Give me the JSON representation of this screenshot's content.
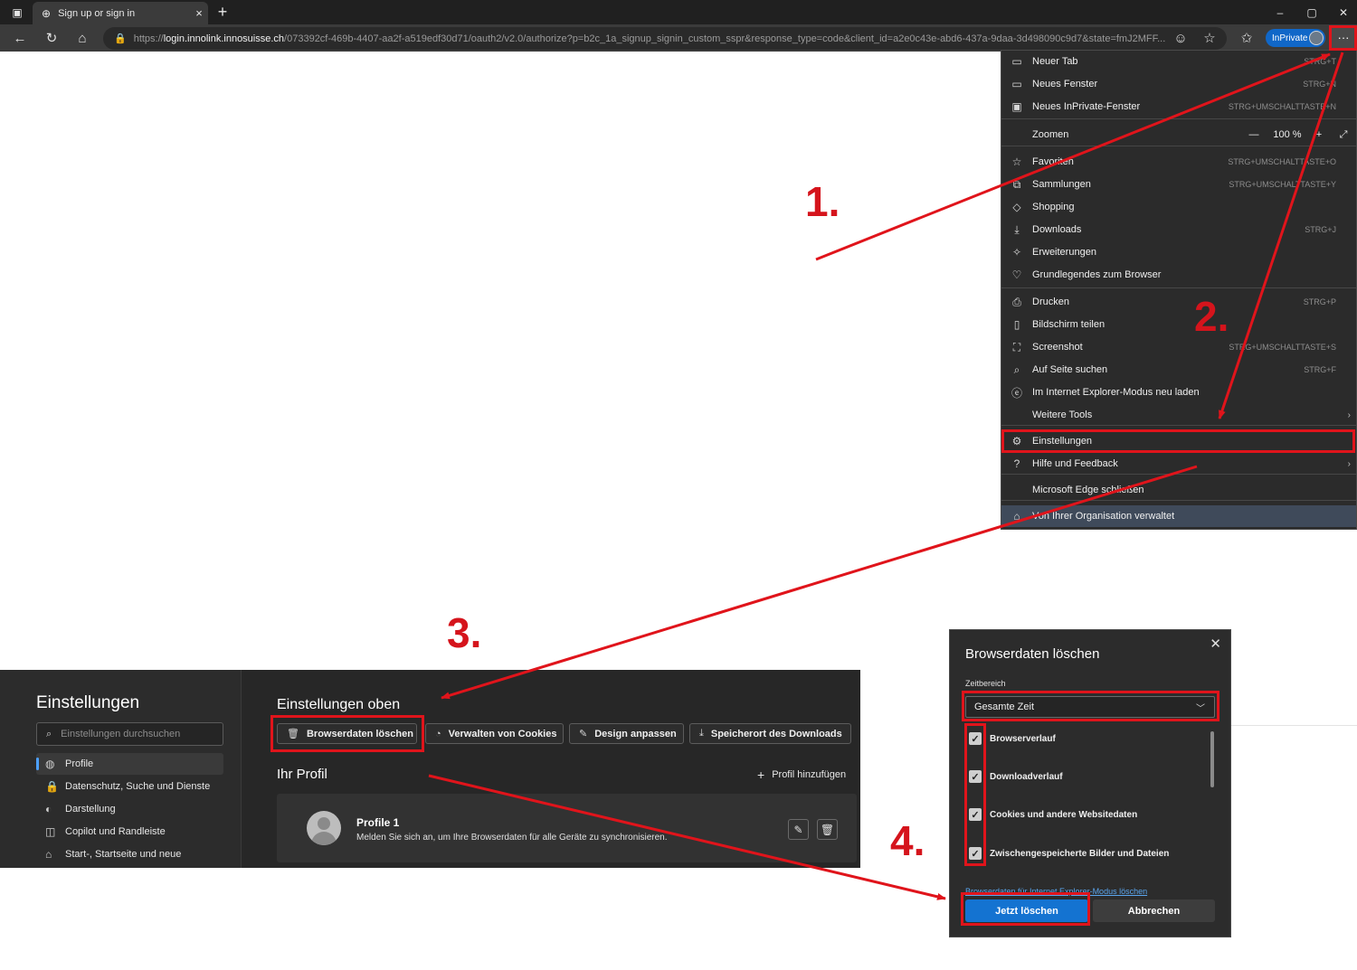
{
  "browser": {
    "tab_title": "Sign up or sign in",
    "tab_close": "×",
    "new_tab": "+",
    "window_controls": {
      "minimize": "–",
      "restore": "▢",
      "close": "✕"
    },
    "url_scheme": "https://",
    "url_host": "login.innolink.innosuisse.ch",
    "url_rest": "/073392cf-469b-4407-aa2f-a519edf30d71/oauth2/v2.0/authorize?p=b2c_1a_signup_signin_custom_sspr&response_type=code&client_id=a2e0c43e-abd6-437a-9daa-3d498090c9d7&state=fmJ2MFF...",
    "inprivate_label": "InPrivate",
    "more_button": "···"
  },
  "menu": {
    "items": [
      {
        "icon": "new-tab-icon",
        "glyph": "▭",
        "label": "Neuer Tab",
        "shortcut": "STRG+T"
      },
      {
        "icon": "new-window-icon",
        "glyph": "▭",
        "label": "Neues Fenster",
        "shortcut": "STRG+N"
      },
      {
        "icon": "inprivate-window-icon",
        "glyph": "▣",
        "label": "Neues InPrivate-Fenster",
        "shortcut": "STRG+UMSCHALTTASTE+N"
      },
      {
        "icon": "",
        "glyph": "",
        "label": "Zoomen",
        "shortcut": ""
      },
      {
        "icon": "favorites-icon",
        "glyph": "☆",
        "label": "Favoriten",
        "shortcut": "STRG+UMSCHALTTASTE+O"
      },
      {
        "icon": "collections-icon",
        "glyph": "⧉",
        "label": "Sammlungen",
        "shortcut": "STRG+UMSCHALTTASTE+Y"
      },
      {
        "icon": "shopping-icon",
        "glyph": "◇",
        "label": "Shopping",
        "shortcut": ""
      },
      {
        "icon": "downloads-icon",
        "glyph": "⤓",
        "label": "Downloads",
        "shortcut": "STRG+J"
      },
      {
        "icon": "extensions-icon",
        "glyph": "✧",
        "label": "Erweiterungen",
        "shortcut": ""
      },
      {
        "icon": "browser-essentials-icon",
        "glyph": "♡",
        "label": "Grundlegendes zum Browser",
        "shortcut": ""
      },
      {
        "icon": "print-icon",
        "glyph": "⎙",
        "label": "Drucken",
        "shortcut": "STRG+P"
      },
      {
        "icon": "screen-share-icon",
        "glyph": "▯",
        "label": "Bildschirm teilen",
        "shortcut": ""
      },
      {
        "icon": "screenshot-icon",
        "glyph": "⛶",
        "label": "Screenshot",
        "shortcut": "STRG+UMSCHALTTASTE+S"
      },
      {
        "icon": "find-on-page-icon",
        "glyph": "⌕",
        "label": "Auf Seite suchen",
        "shortcut": "STRG+F"
      },
      {
        "icon": "ie-mode-icon",
        "glyph": "ⓔ",
        "label": "Im Internet Explorer-Modus neu laden",
        "shortcut": ""
      },
      {
        "icon": "",
        "glyph": "",
        "label": "Weitere Tools",
        "shortcut": ""
      },
      {
        "icon": "settings-gear-icon",
        "glyph": "⚙",
        "label": "Einstellungen",
        "shortcut": ""
      },
      {
        "icon": "help-icon",
        "glyph": "?",
        "label": "Hilfe und Feedback",
        "shortcut": ""
      },
      {
        "icon": "",
        "glyph": "",
        "label": "Microsoft Edge schließen",
        "shortcut": ""
      },
      {
        "icon": "briefcase-icon",
        "glyph": "⌂",
        "label": "Von Ihrer Organisation verwaltet",
        "shortcut": ""
      }
    ],
    "zoom": {
      "minus": "—",
      "value": "100 %",
      "plus": "+",
      "fullscreen": "⤢"
    },
    "submenu_arrow": "›"
  },
  "settings": {
    "title": "Einstellungen",
    "search_placeholder": "Einstellungen durchsuchen",
    "sidebar": [
      {
        "glyph": "◍",
        "label": "Profile"
      },
      {
        "glyph": "🔒",
        "label": "Datenschutz, Suche und Dienste"
      },
      {
        "glyph": "◐",
        "label": "Darstellung"
      },
      {
        "glyph": "◫",
        "label": "Copilot und Randleiste"
      },
      {
        "glyph": "⌂",
        "label": "Start-, Startseite und neue"
      }
    ],
    "top_title": "Einstellungen oben",
    "chips": [
      {
        "glyph": "🗑",
        "label": "Browserdaten löschen"
      },
      {
        "glyph": "◔",
        "label": "Verwalten von Cookies"
      },
      {
        "glyph": "✎",
        "label": "Design anpassen"
      },
      {
        "glyph": "⤓",
        "label": "Speicherort des Downloads"
      }
    ],
    "profile_section_title": "Ihr Profil",
    "add_profile": "Profil hinzufügen",
    "profile_name": "Profile 1",
    "profile_desc": "Melden Sie sich an, um Ihre Browserdaten für alle Geräte zu synchronisieren."
  },
  "dialog": {
    "title": "Browserdaten löschen",
    "close": "✕",
    "range_label": "Zeitbereich",
    "range_value": "Gesamte Zeit",
    "checkboxes": [
      {
        "label": "Browserverlauf",
        "checked": true
      },
      {
        "label": "Downloadverlauf",
        "checked": true
      },
      {
        "label": "Cookies und andere Websitedaten",
        "checked": true
      },
      {
        "label": "Zwischengespeicherte Bilder und Dateien",
        "checked": true
      }
    ],
    "ie_link": "Browserdaten für Internet Explorer-Modus löschen",
    "clear_button": "Jetzt löschen",
    "cancel_button": "Abbrechen"
  },
  "annotations": {
    "color": "#e0141b",
    "steps": [
      "1.",
      "2.",
      "3.",
      "4."
    ]
  }
}
